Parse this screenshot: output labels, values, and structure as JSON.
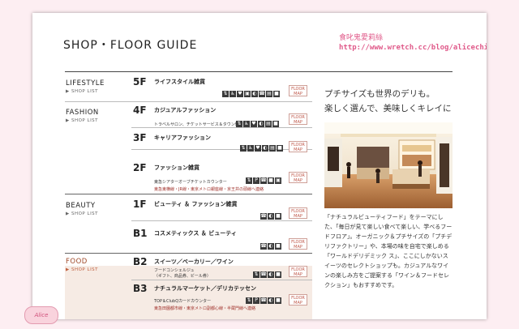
{
  "watermark": {
    "line1": "食叱鬼愛莉絲",
    "line2": "http://www.wretch.cc/blog/alicechica"
  },
  "page_title": "SHOP・FLOOR GUIDE",
  "categories": [
    {
      "name": "LIFESTYLE",
      "sub": "▶ SHOP LIST"
    },
    {
      "name": "FASHION",
      "sub": "▶ SHOP LIST"
    },
    {
      "name": "BEAUTY",
      "sub": "▶ SHOP LIST"
    },
    {
      "name": "FOOD",
      "sub": "▶ SHOP LIST"
    }
  ],
  "floors": [
    {
      "floor": "5F",
      "name": "ライフスタイル雑貨",
      "sub": [],
      "red": "",
      "btn": "FLOOR MAP"
    },
    {
      "floor": "4F",
      "name": "カジュアルファッション",
      "sub": [
        "トラベルサロン、チケットサービス＆タウン情報"
      ],
      "red": "",
      "btn": "FLOOR MAP"
    },
    {
      "floor": "3F",
      "name": "キャリアファッション",
      "sub": [],
      "red": "",
      "btn": "FLOOR MAP"
    },
    {
      "floor": "2F",
      "name": "ファッション雑貨",
      "sub": [
        "東急シアターオーブチケットカウンター"
      ],
      "red": "東急東横線・JR線・東京メトロ銀座線・京王井の頭線へ連絡",
      "btn": "FLOOR MAP"
    },
    {
      "floor": "1F",
      "name": "ビューティ ＆ ファッション雑貨",
      "sub": [],
      "red": "",
      "btn": "FLOOR MAP"
    },
    {
      "floor": "B1",
      "name": "コスメティックス ＆ ビューティ",
      "sub": [],
      "red": "",
      "btn": "FLOOR MAP"
    },
    {
      "floor": "B2",
      "name": "スイーツ／ベーカリー／ワイン",
      "sub": [
        "フードコンシェルジュ",
        "（ギフト、商品券、ビール券）"
      ],
      "red": "",
      "btn": "FLOOR MAP"
    },
    {
      "floor": "B3",
      "name": "ナチュラルマーケット／デリカテッセン",
      "sub": [
        "TOP＆ClubQカードカウンター"
      ],
      "red": "東急田園都市線・東京メトロ副都心線・半蔵門線へ連絡",
      "btn": "FLOOR MAP"
    }
  ],
  "side": {
    "title1": "プチサイズも世界のデリも。",
    "title2": "楽しく選んで、美味しくキレイに",
    "description": "「ナチュラルビューティフード」をテーマにした、「毎日が見て楽しい食べて楽しい、学べるフードフロア」。オーガニック＆プチサイズの「プチデリファクトリー」や、本場の味を自宅で楽しめる「ワールドデリデミック ス」、ここにしかないスイーツのセレクトショップも。カジュアルなワインの楽しみ方をご提案する「ワイン＆フードセレクション」もおすすめです。"
  },
  "deco_label": "Alice"
}
